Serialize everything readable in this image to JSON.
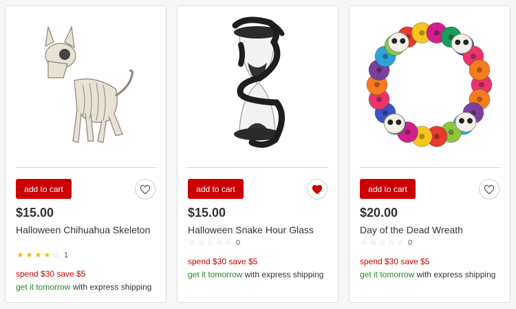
{
  "colors": {
    "accent": "#cc0000",
    "shipping_green": "#228822",
    "star_on": "#f2b30f",
    "star_off": "#c9c9c9"
  },
  "products": [
    {
      "image_icon": "chihuahua-skeleton-image",
      "add_to_cart_label": "add to cart",
      "favorite_icon": "heart-outline-icon",
      "favorited": false,
      "price": "$15.00",
      "title": "Halloween Chihuahua Skeleton",
      "rating": 4,
      "rating_max": 5,
      "rating_count": "1",
      "promo": "spend $30 save $5",
      "shipping_highlight": "get it tomorrow",
      "shipping_rest": " with express shipping"
    },
    {
      "image_icon": "snake-hourglass-image",
      "add_to_cart_label": "add to cart",
      "favorite_icon": "heart-filled-icon",
      "favorited": true,
      "price": "$15.00",
      "title": "Halloween Snake Hour Glass",
      "rating": 0,
      "rating_max": 5,
      "rating_count": "0",
      "promo": "spend $30 save $5",
      "shipping_highlight": "get it tomorrow",
      "shipping_rest": " with express shipping"
    },
    {
      "image_icon": "day-of-dead-wreath-image",
      "add_to_cart_label": "add to cart",
      "favorite_icon": "heart-outline-icon",
      "favorited": false,
      "price": "$20.00",
      "title": "Day of the Dead Wreath",
      "rating": 0,
      "rating_max": 5,
      "rating_count": "0",
      "promo": "spend $30 save $5",
      "shipping_highlight": "get it tomorrow",
      "shipping_rest": " with express shipping"
    }
  ]
}
